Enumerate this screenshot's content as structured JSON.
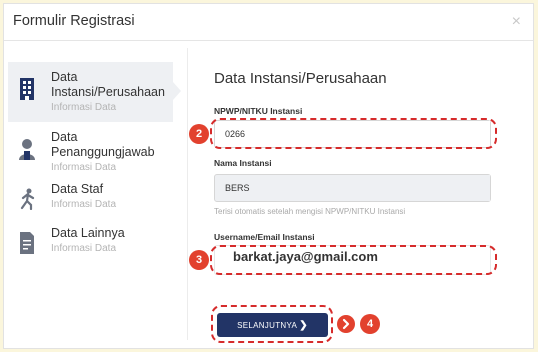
{
  "modal": {
    "title": "Formulir Registrasi",
    "close_symbol": "×"
  },
  "sidebar": {
    "items": [
      {
        "title": "Data Instansi/Perusahaan",
        "subtitle": "Informasi Data",
        "icon": "building-icon",
        "active": true
      },
      {
        "title": "Data Penanggungjawab",
        "subtitle": "Informasi Data",
        "icon": "person-icon",
        "active": false
      },
      {
        "title": "Data Staf",
        "subtitle": "Informasi Data",
        "icon": "running-person-icon",
        "active": false
      },
      {
        "title": "Data Lainnya",
        "subtitle": "Informasi Data",
        "icon": "document-icon",
        "active": false
      }
    ]
  },
  "form": {
    "section_title": "Data Instansi/Perusahaan",
    "npwp": {
      "label": "NPWP/NITKU Instansi",
      "value": "0266"
    },
    "nama": {
      "label": "Nama Instansi",
      "value": "BERS",
      "hint": "Terisi otomatis setelah mengisi NPWP/NITKU Instansi"
    },
    "email": {
      "label": "Username/Email Instansi",
      "value": "barkat.jaya@gmail.com"
    },
    "next_button": "SELANJUTNYA"
  },
  "annotations": {
    "badge_2": "2",
    "badge_3": "3",
    "badge_4": "4"
  },
  "colors": {
    "accent": "#223466",
    "annotation": "#d62b2b",
    "badge": "#e2412e",
    "background": "#fbf6dc"
  }
}
